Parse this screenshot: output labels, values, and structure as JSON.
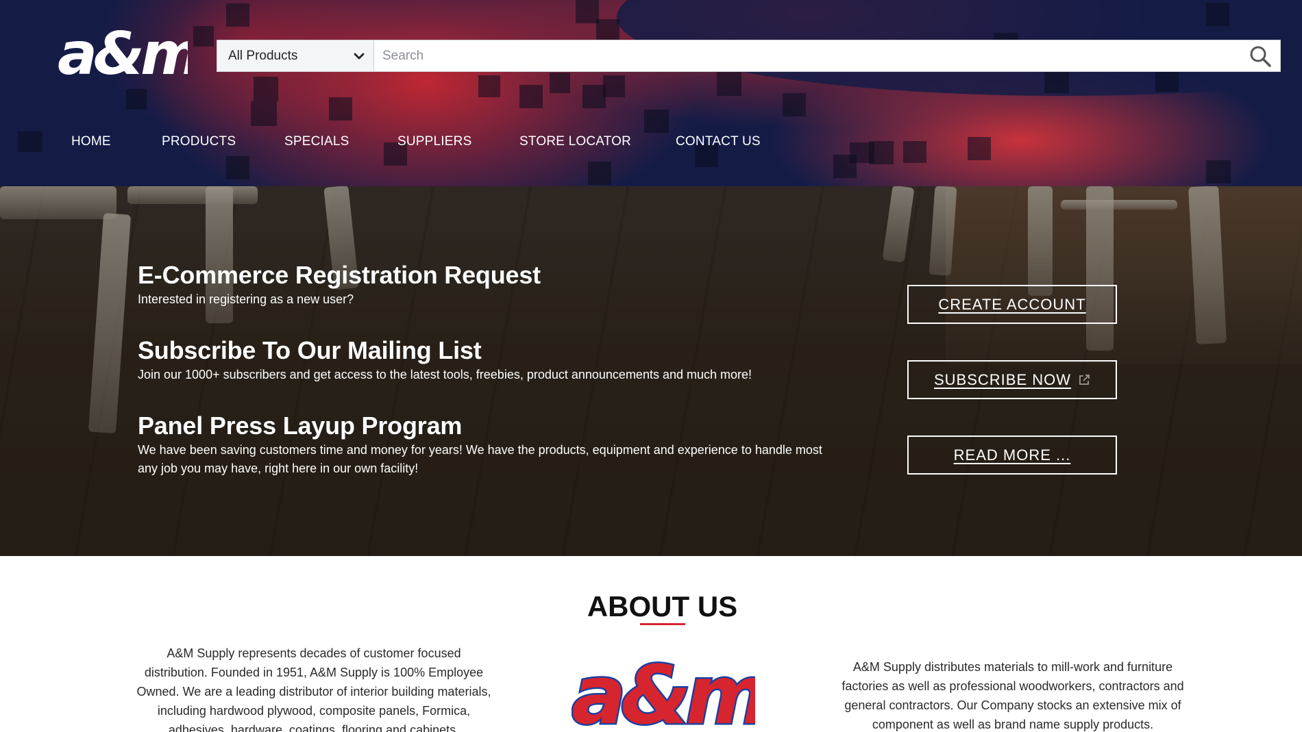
{
  "header": {
    "logo_text": "a&m",
    "category_select": {
      "selected": "All Products"
    },
    "search": {
      "placeholder": "Search",
      "value": ""
    },
    "nav": [
      "HOME",
      "PRODUCTS",
      "SPECIALS",
      "SUPPLIERS",
      "STORE LOCATOR",
      "CONTACT US"
    ]
  },
  "hero": {
    "promos": [
      {
        "title": "E-Commerce Registration Request",
        "desc": "Interested in registering as a new user?",
        "button": "CREATE ACCOUNT",
        "external": false
      },
      {
        "title": "Subscribe To Our Mailing List",
        "desc": "Join our 1000+ subscribers and get access to the latest tools, freebies, product announcements and much more!",
        "button": "SUBSCRIBE NOW",
        "external": true
      },
      {
        "title": "Panel Press Layup Program",
        "desc": "We have been saving customers time and money for years! We have the products, equipment and experience to handle most any job you may have, right here in our own facility!",
        "button": "READ MORE ...",
        "external": false
      }
    ]
  },
  "about": {
    "title": "ABOUT US",
    "left_text": "A&M Supply represents decades of customer focused distribution. Founded in 1951, A&M Supply is 100% Employee Owned. We are a leading distributor of interior building materials, including hardwood plywood, composite panels, Formica, adhesives, hardware, coatings, flooring and cabinets.",
    "right_text": "A&M Supply distributes materials to mill-work and furniture factories as well as professional woodworkers, contractors and general contractors. Our Company stocks an extensive mix of component as well as brand name supply products.",
    "logo_text": "a&m"
  },
  "colors": {
    "navy": "#141c46",
    "brand_red": "#d6252f",
    "brand_blue": "#1f3f9e"
  }
}
